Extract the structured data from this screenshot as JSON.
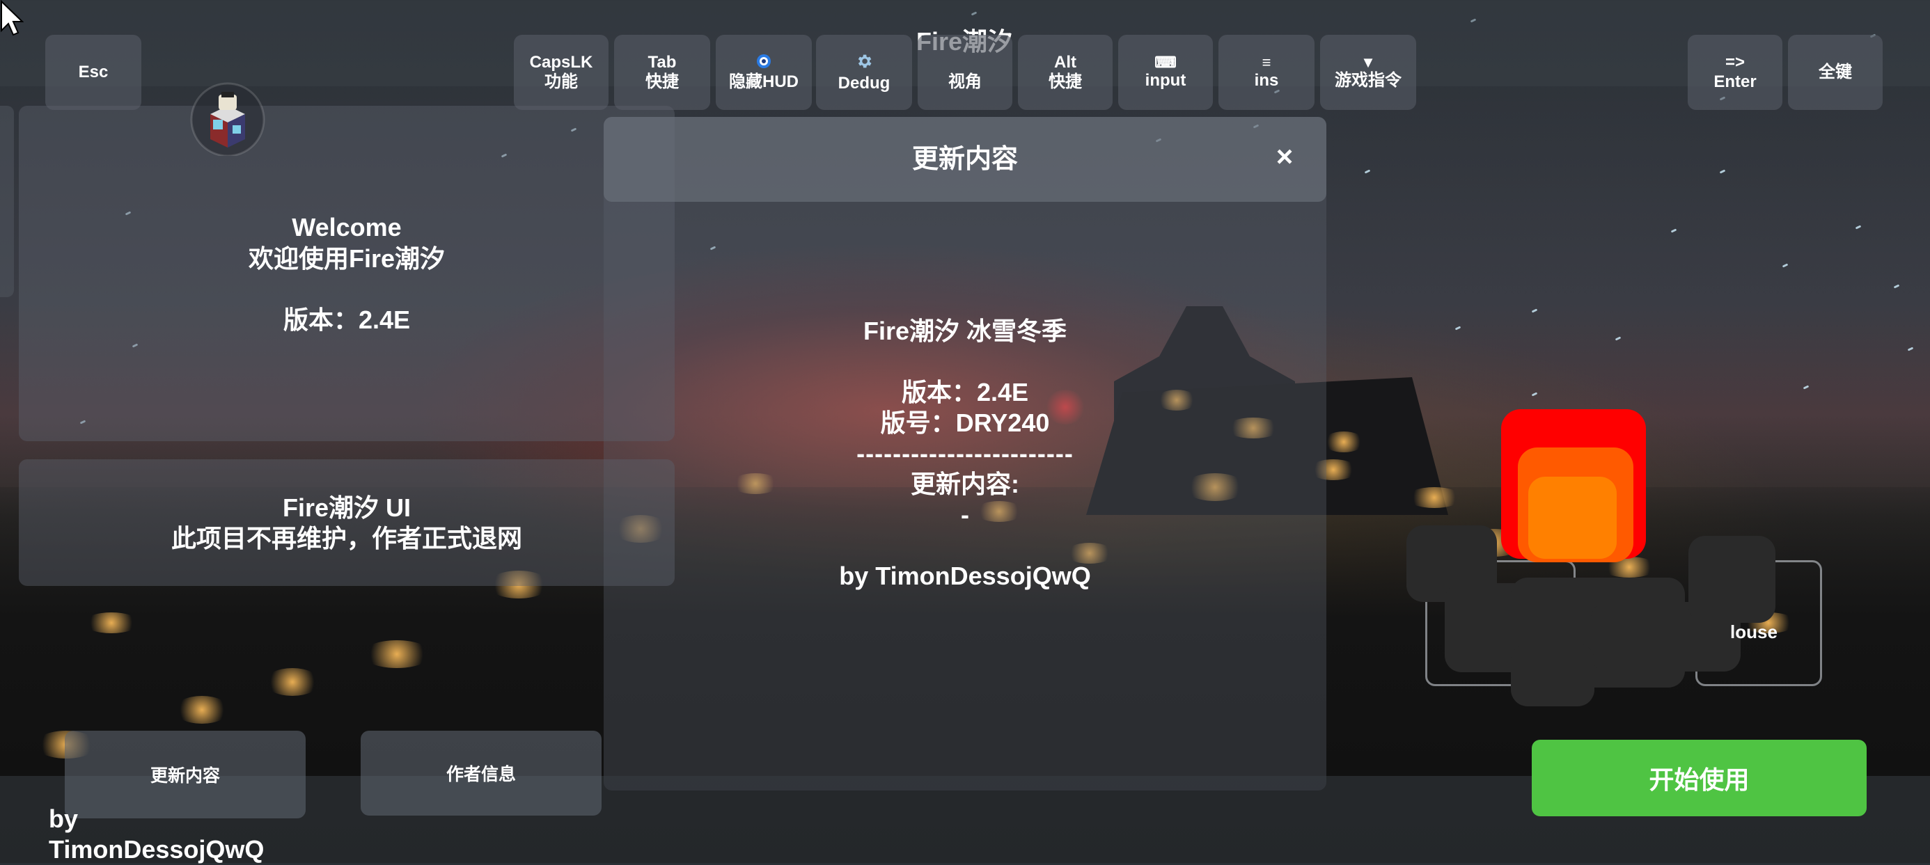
{
  "app_title": "Fire潮汐",
  "keys": {
    "esc": "Esc",
    "capslk_line1": "CapsLK",
    "capslk_line2": "功能",
    "tab_line1": "Tab",
    "tab_line2": "快捷",
    "hud_label": "隐藏HUD",
    "debug_label": "Dedug",
    "view_label": "视角",
    "alt_line1": "Alt",
    "alt_line2": "快捷",
    "input_label": "input",
    "ins_label": "ins",
    "cmd_label": "游戏指令",
    "enter_line1": "=>",
    "enter_line2": "Enter",
    "allkeys_label": "全键"
  },
  "icons": {
    "hud_icon": "eye-icon",
    "debug_icon": "gear-icon",
    "input_icon": "keyboard-icon",
    "ins_icon": "menu-icon",
    "cmd_icon": "triangle-down-icon"
  },
  "welcome_panel": {
    "line1": "Welcome",
    "line2": "欢迎使用Fire潮汐",
    "version": "版本：2.4E"
  },
  "notice_panel": {
    "title": "Fire潮汐 UI",
    "message": "此项目不再维护，作者正式退网"
  },
  "update_dialog": {
    "header": "更新内容",
    "close": "×",
    "name": "Fire潮汐 冰雪冬季",
    "version": "版本：2.4E",
    "build": "版号：DRY240",
    "separator": "------------------------",
    "content_label": "更新内容:",
    "content_value": "-",
    "author": "by TimonDessojQwQ"
  },
  "bottom": {
    "update_button": "更新内容",
    "author_button": "作者信息",
    "author_credit": "by TimonDessojQwQ",
    "start_button": "开始使用"
  },
  "mouse_widget_label": "louse",
  "colors": {
    "start_button": "#4fc443",
    "icon_red": "#ff0000",
    "icon_orange": "#ff8000"
  }
}
